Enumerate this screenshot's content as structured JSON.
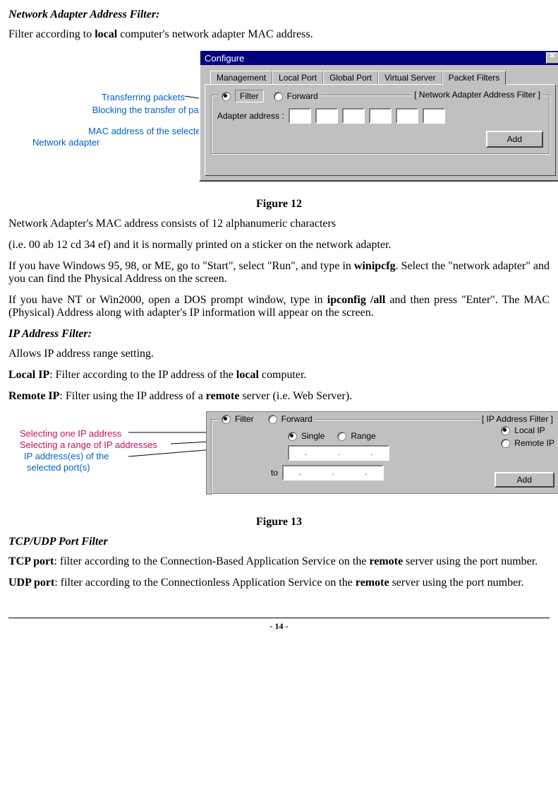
{
  "section1_title": "Network Adapter Address Filter:",
  "para1_a": "Filter according to ",
  "para1_b": "local",
  "para1_c": " computer's network adapter MAC address.",
  "fig12": {
    "window_title": "Configure",
    "tabs": [
      "Management",
      "Local Port",
      "Global Port",
      "Virtual Server",
      "Packet Filters"
    ],
    "group_title": "[ Network Adapter Address Filter ]",
    "radio_filter": "Filter",
    "radio_forward": "Forward",
    "adapter_label": "Adapter address :",
    "add_btn": "Add",
    "annotation1": "Transferring packets",
    "annotation2": "Blocking the transfer of packets",
    "annotation3a": "MAC address of the selected",
    "annotation3b": "Network adapter",
    "caption": "Figure 12"
  },
  "para2": "Network Adapter's MAC address consists of 12 alphanumeric characters",
  "para3_a": "(i.e. 00 ab 12 cd 34 ef) and it is normally printed on a sticker on the network adapter.",
  "para4_a": "If you have Windows 95, 98, or ME, go to \"Start\", select \"Run\", and type in ",
  "para4_b": "winipcfg",
  "para4_c": ". Select the \"network adapter\" and you can find the Physical Address on the screen.",
  "para5_a": "If you have NT or Win2000, open a DOS prompt window, type in ",
  "para5_b": "ipconfig /all",
  "para5_c": " and then press \"Enter\". The MAC (Physical) Address along with adapter's IP information will appear on the screen.",
  "section2_title": "IP Address Filter:",
  "para6": "Allows IP address range setting.",
  "para7_a": "Local IP",
  "para7_b": ": Filter according to the IP address of the ",
  "para7_c": "local",
  "para7_d": " computer.",
  "para8_a": "Remote IP",
  "para8_b": ": Filter using the IP address of a ",
  "para8_c": "remote",
  "para8_d": " server (i.e. Web Server).",
  "fig13": {
    "group_title": "[ IP Address Filter ]",
    "radio_filter": "Filter",
    "radio_forward": "Forward",
    "radio_single": "Single",
    "radio_range": "Range",
    "radio_local": "Local IP",
    "radio_remote": "Remote IP",
    "to_label": "to",
    "add_btn": "Add",
    "annotation1": "Selecting one IP address",
    "annotation2": "Selecting a range of IP addresses",
    "annotation3a": "IP address(es) of the",
    "annotation3b": "selected port(s)",
    "caption": "Figure 13"
  },
  "section3_title": "TCP/UDP Port Filter",
  "para9_a": "TCP port",
  "para9_b": ": filter according to the Connection-Based Application Service on the ",
  "para9_c": "remote",
  "para9_d": " server using the port number.",
  "para10_a": "UDP port",
  "para10_b": ": filter according to the Connectionless Application Service on the ",
  "para10_c": "remote",
  "para10_d": " server using the port number.",
  "footer": "- 14 -"
}
